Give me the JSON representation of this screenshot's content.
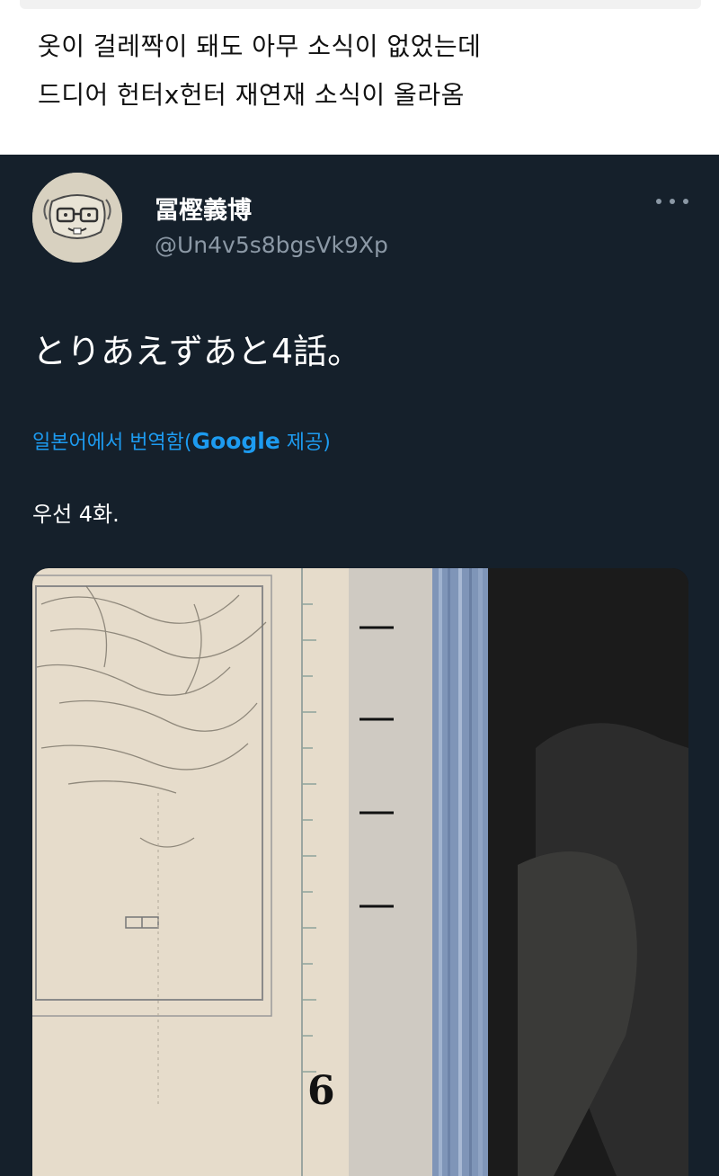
{
  "caption": {
    "line1": "옷이 걸레짝이 돼도 아무 소식이 없었는데",
    "line2": "드디어 헌터x헌터 재연재 소식이 올라옴"
  },
  "tweet": {
    "author_name": "冨樫義博",
    "author_handle": "@Un4v5s8bgsVk9Xp",
    "text": "とりあえずあと4話。",
    "translation_label": "일본어에서 번역함(",
    "translation_provider": "Google",
    "translation_suffix": " 제공)",
    "translated_text": "우선 4화.",
    "media_label": "6"
  },
  "colors": {
    "tweet_background": "#15202b",
    "link_blue": "#1d9bf0",
    "muted_text": "#8b98a5"
  }
}
